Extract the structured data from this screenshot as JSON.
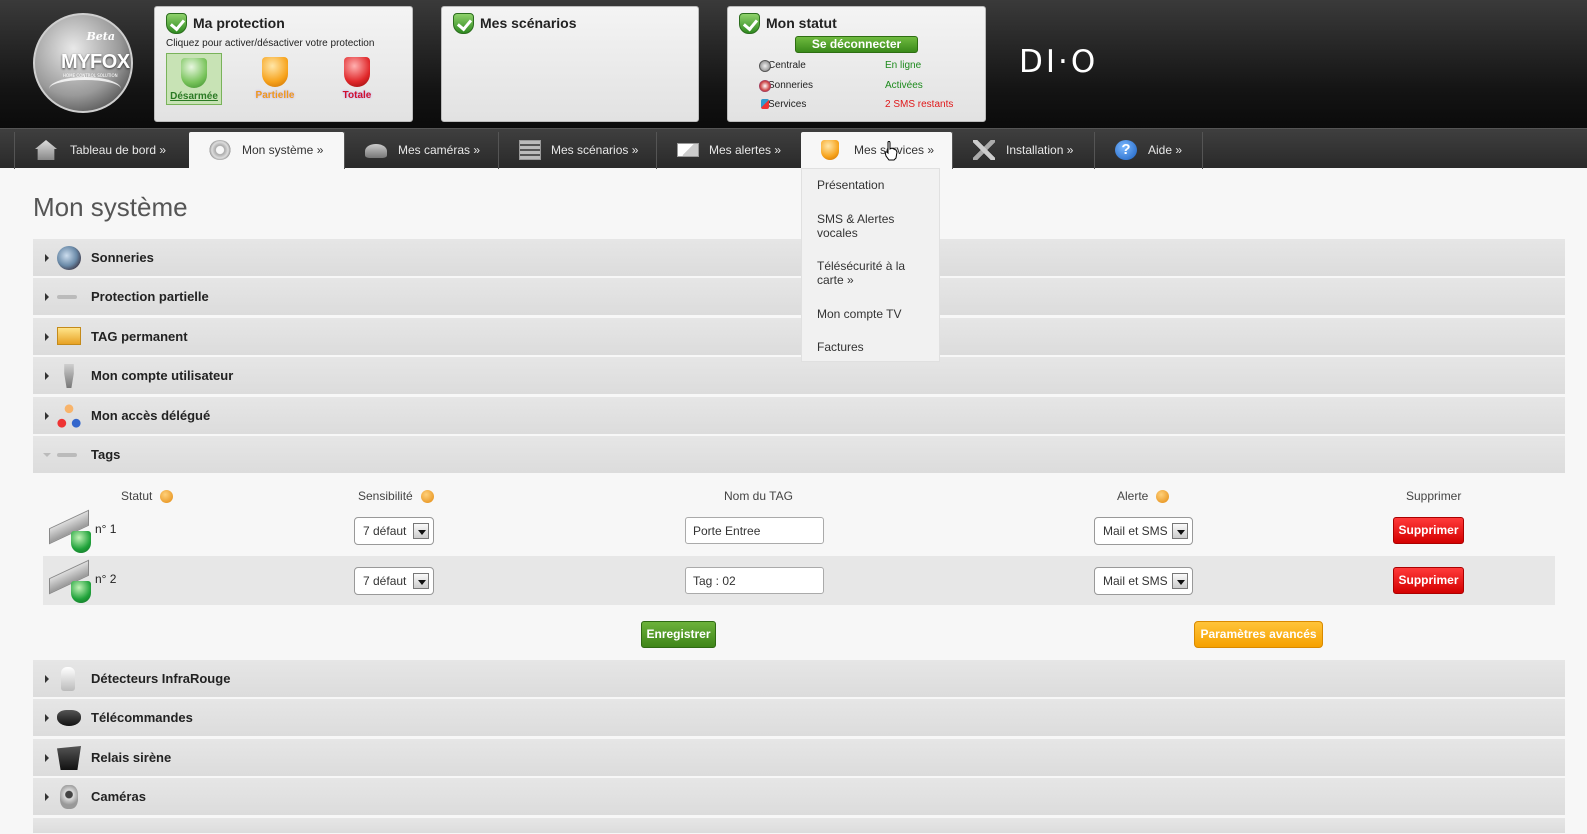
{
  "colors": {
    "accent_green": "#3f8519",
    "danger_red": "#e0181a",
    "warning_orange": "#f6a100",
    "header_bg": "#141414"
  },
  "logo": {
    "beta": "Beta",
    "brand": "MYFOX",
    "tagline": "HOME CONTROL SOLUTION"
  },
  "brand_partner": "DI·O",
  "protection_panel": {
    "title": "Ma protection",
    "subtitle": "Cliquez pour activer/désactiver votre protection",
    "modes": [
      {
        "label": "Désarmée",
        "icon": "shield-green-icon",
        "active": true
      },
      {
        "label": "Partielle",
        "icon": "shield-orange-icon",
        "active": false
      },
      {
        "label": "Totale",
        "icon": "shield-red-icon",
        "active": false
      }
    ]
  },
  "scenarios_panel": {
    "title": "Mes scénarios"
  },
  "status_panel": {
    "title": "Mon statut",
    "disconnect_label": "Se déconnecter",
    "rows": [
      {
        "label": "Centrale",
        "value": "En ligne"
      },
      {
        "label": "Sonneries",
        "value": "Activées"
      },
      {
        "label": "Services",
        "value": "2 SMS restants"
      }
    ]
  },
  "nav": {
    "items": [
      {
        "label": "Tableau de bord »",
        "icon": "home-icon"
      },
      {
        "label": "Mon système »",
        "icon": "gear-icon",
        "active": true
      },
      {
        "label": "Mes caméras »",
        "icon": "camera-icon"
      },
      {
        "label": "Mes scénarios »",
        "icon": "list-icon"
      },
      {
        "label": "Mes alertes »",
        "icon": "mail-icon"
      },
      {
        "label": "Mes services »",
        "icon": "shield-icon",
        "hovered": true
      },
      {
        "label": "Installation »",
        "icon": "tools-icon"
      },
      {
        "label": "Aide »",
        "icon": "help-icon"
      }
    ],
    "dropdown": [
      "Présentation",
      "SMS & Alertes vocales",
      "Télésécurité à la carte »",
      "Mon compte TV",
      "Factures"
    ]
  },
  "page_title": "Mon système",
  "sections_top": [
    {
      "label": "Sonneries",
      "icon": "siren-icon"
    },
    {
      "label": "Protection partielle",
      "icon": "bar-icon"
    },
    {
      "label": "TAG permanent",
      "icon": "tag-icon"
    },
    {
      "label": "Mon compte utilisateur",
      "icon": "user-icon"
    },
    {
      "label": "Mon accès délégué",
      "icon": "delegate-icon"
    },
    {
      "label": "Tags",
      "icon": "bar-icon",
      "expanded": true
    }
  ],
  "tags_table": {
    "headers": {
      "statut": "Statut",
      "sensibilite": "Sensibilité",
      "nom": "Nom du TAG",
      "alerte": "Alerte",
      "supprimer": "Supprimer"
    },
    "rows": [
      {
        "num": "n° 1",
        "sensibilite": "7 défaut",
        "nom": "Porte Entree",
        "alerte": "Mail et SMS",
        "delete": "Supprimer"
      },
      {
        "num": "n° 2",
        "sensibilite": "7 défaut",
        "nom": "Tag : 02",
        "alerte": "Mail et SMS",
        "delete": "Supprimer"
      }
    ],
    "save_label": "Enregistrer",
    "advanced_label": "Paramètres avancés"
  },
  "sections_bottom": [
    {
      "label": "Détecteurs InfraRouge",
      "icon": "ir-detector-icon"
    },
    {
      "label": "Télécommandes",
      "icon": "remote-icon"
    },
    {
      "label": "Relais sirène",
      "icon": "relay-icon"
    },
    {
      "label": "Caméras",
      "icon": "camera-icon"
    }
  ]
}
